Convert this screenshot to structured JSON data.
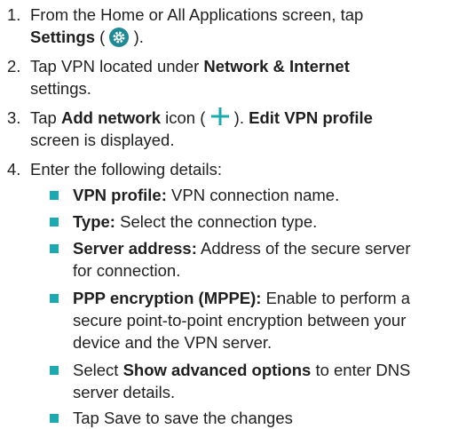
{
  "steps": [
    {
      "number": "1.",
      "line1": "From the Home or All Applications screen, tap",
      "bold": "Settings",
      "open_paren": " ( ",
      "close_paren": " )."
    },
    {
      "number": "2.",
      "pre": "Tap VPN located under ",
      "bold": "Network & Internet",
      "line2": "settings."
    },
    {
      "number": "3.",
      "pre": "Tap ",
      "bold1": "Add network",
      "mid": " icon ( ",
      "post": " ). ",
      "bold2": "Edit VPN profile",
      "line2": "screen is displayed."
    },
    {
      "number": "4.",
      "text": "Enter the following details:"
    }
  ],
  "bullets": [
    {
      "bold": "VPN profile:",
      "text": " VPN connection name."
    },
    {
      "bold": "Type:",
      "text": " Select the connection type."
    },
    {
      "bold": "Server address:",
      "text": " Address of the secure server",
      "line2": "for connection."
    },
    {
      "bold": "PPP encryption (MPPE):",
      "text": " Enable to perform a",
      "line2": "secure point-to-point encryption between your",
      "line3": "device and the VPN server."
    },
    {
      "pre": "Select ",
      "bold": "Show advanced options",
      "text": " to enter DNS",
      "line2": "server details."
    },
    {
      "text": "Tap Save to save the changes"
    }
  ],
  "icons": {
    "settings": "settings-gear-icon",
    "add": "plus-icon"
  },
  "colors": {
    "settings_icon_bg": "#1d8a96",
    "plus_icon": "#1ca9b0",
    "bullet": "#1ca9b0",
    "text": "#1f1f1f"
  }
}
